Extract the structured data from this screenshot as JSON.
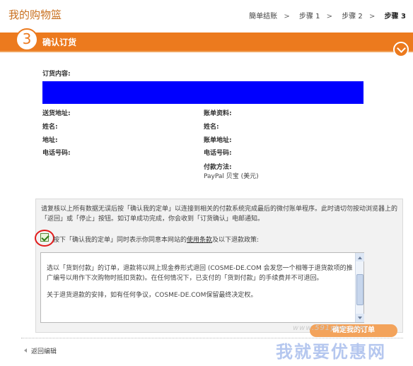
{
  "header": {
    "title": "我的购物篮",
    "steps": [
      "簡单结账",
      "步骤 1",
      "步骤 2",
      "步骤 3"
    ],
    "separator": ">"
  },
  "section": {
    "number": "3",
    "title": "确认订货"
  },
  "order": {
    "content_label": "订货内容:",
    "shipping_address_label": "送货地址:",
    "name_label_left": "姓名:",
    "address_label_left": "地址:",
    "phone_label_left": "电话号码:",
    "billing_label": "账单资料:",
    "name_label_right": "姓名:",
    "billing_address_label": "账单地址:",
    "phone_label_right": "电话号码:",
    "payment_label": "付款方法:",
    "payment_value": "PayPal 贝宝 (美元)"
  },
  "notice": {
    "text": "请复核以上所有数据无误后按「确认我的定单」以连接到相关的付款系统完成最后的微付账单程序。此时请切勿按动浏览器上的「返回」或「停止」按钮。如订单成功完成，你会收到「订货确认」电邮通知。",
    "agree_prefix": "按下「确认我的定单」同时表示你同意本网站的",
    "agree_link": "使用条款",
    "agree_suffix": "及以下退款政策:"
  },
  "policy": {
    "para1": "选以「货到付款」的订单，退款将以网上现金券形式退回 (COSME-DE.COM 会发您一个相等于退货款项的推广编号以用作下次购物时抵扣货款)。在任何情况下，已支付的「货到付款」的手续费并不可退回。",
    "para2": "关于退货退款的安排，如有任何争议，COSME-DE.COM保留最终决定权。"
  },
  "footer": {
    "back_label": "返回编辑",
    "confirm_label": "确定我的订单"
  },
  "watermark": {
    "url": "www.591yhw.com",
    "text": "我就要优惠网"
  },
  "colors": {
    "accent_orange": "#ec7a1e",
    "blue_block": "#0000ff",
    "highlight_red": "#e21b1b"
  }
}
